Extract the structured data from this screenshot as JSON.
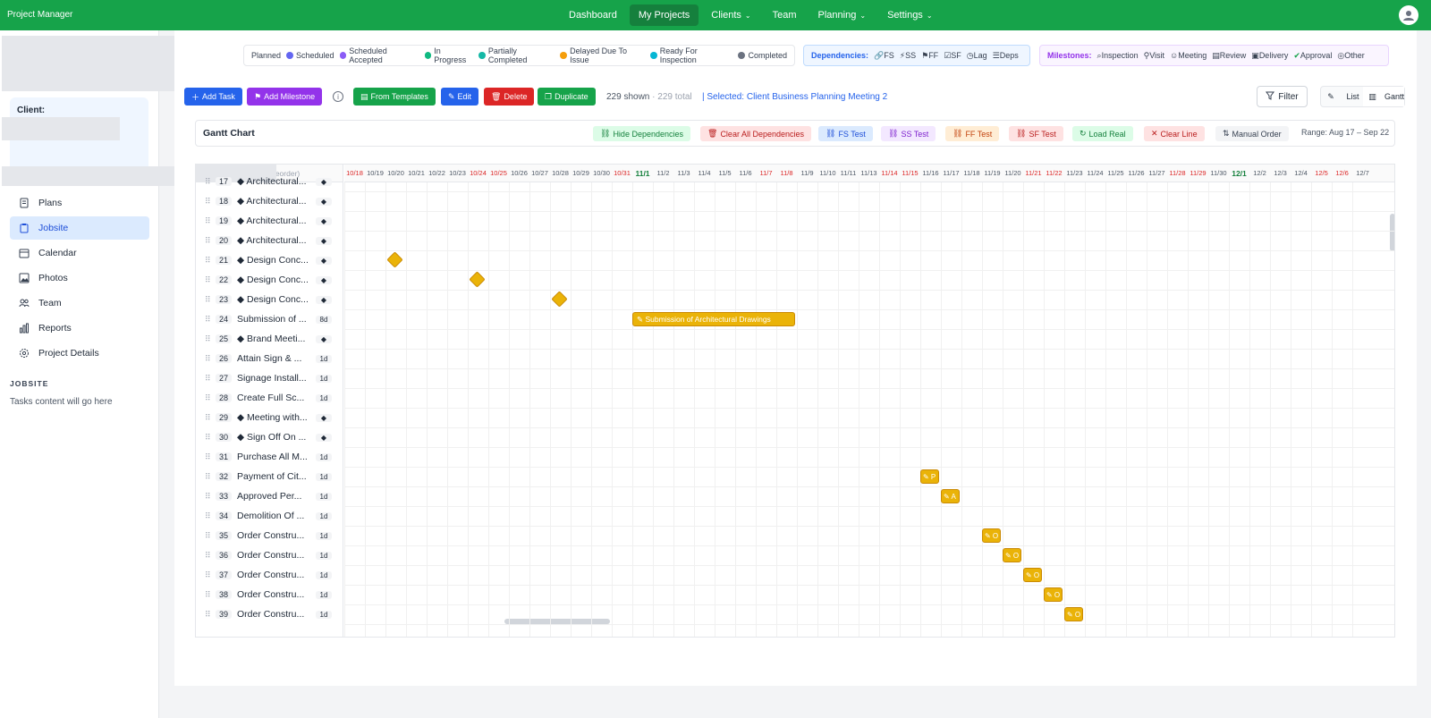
{
  "app": {
    "title": "Project Manager"
  },
  "nav": {
    "items": [
      {
        "label": "Dashboard",
        "active": false
      },
      {
        "label": "My Projects",
        "active": true
      },
      {
        "label": "Clients",
        "active": false
      },
      {
        "label": "Team",
        "active": false
      },
      {
        "label": "Planning",
        "active": false
      },
      {
        "label": "Settings",
        "active": false
      }
    ]
  },
  "sidebar": {
    "client_label": "Client:",
    "items": [
      {
        "label": "Plans",
        "icon": "document-icon"
      },
      {
        "label": "Jobsite",
        "icon": "clipboard-icon"
      },
      {
        "label": "Calendar",
        "icon": "calendar-icon"
      },
      {
        "label": "Photos",
        "icon": "photo-icon"
      },
      {
        "label": "Team",
        "icon": "team-icon"
      },
      {
        "label": "Reports",
        "icon": "reports-icon"
      },
      {
        "label": "Project Details",
        "icon": "gear-icon"
      }
    ],
    "section_title": "JOBSITE",
    "section_note": "Tasks content will go here"
  },
  "legend_status": {
    "items": [
      {
        "label": "Planned",
        "color": ""
      },
      {
        "label": "Scheduled",
        "color": "#6366f1"
      },
      {
        "label": "Scheduled Accepted",
        "color": "#8b5cf6"
      },
      {
        "label": "In Progress",
        "color": "#10b981"
      },
      {
        "label": "Partially Completed",
        "color": "#14b8a6"
      },
      {
        "label": "Delayed Due To Issue",
        "color": "#f59e0b"
      },
      {
        "label": "Ready For Inspection",
        "color": "#06b6d4"
      },
      {
        "label": "Completed",
        "color": "#6b7280"
      }
    ]
  },
  "legend_deps": {
    "title": "Dependencies:",
    "items": [
      "FS",
      "SS",
      "FF",
      "SF",
      "Lag",
      "Deps"
    ]
  },
  "legend_milestones": {
    "title": "Milestones:",
    "items": [
      "Inspection",
      "Visit",
      "Meeting",
      "Review",
      "Delivery",
      "Approval",
      "Other"
    ]
  },
  "toolbar": {
    "add_task": "Add Task",
    "add_milestone": "Add Milestone",
    "from_templates": "From Templates",
    "edit": "Edit",
    "delete": "Delete",
    "duplicate": "Duplicate",
    "shown": "229 shown",
    "total": "· 229 total",
    "selected": "| Selected: Client Business Planning Meeting 2",
    "filter": "Filter",
    "view_list": "List",
    "view_gantt": "Gantt"
  },
  "gantt_toolbar": {
    "title": "Gantt Chart",
    "hide_deps": "Hide Dependencies",
    "clear_deps": "Clear All Dependencies",
    "fs_test": "FS Test",
    "ss_test": "SS Test",
    "ff_test": "FF Test",
    "sf_test": "SF Test",
    "load_real": "Load Real",
    "clear_line": "Clear Line",
    "manual_order": "Manual Order",
    "range": "Range:  Aug 17 – Sep 22"
  },
  "gantt": {
    "reorder_hint": "reorder)",
    "dates": [
      {
        "d": "10/18",
        "k": "weekend"
      },
      {
        "d": "10/19",
        "k": ""
      },
      {
        "d": "10/20",
        "k": ""
      },
      {
        "d": "10/21",
        "k": ""
      },
      {
        "d": "10/22",
        "k": ""
      },
      {
        "d": "10/23",
        "k": ""
      },
      {
        "d": "10/24",
        "k": "weekend"
      },
      {
        "d": "10/25",
        "k": "weekend"
      },
      {
        "d": "10/26",
        "k": ""
      },
      {
        "d": "10/27",
        "k": ""
      },
      {
        "d": "10/28",
        "k": ""
      },
      {
        "d": "10/29",
        "k": ""
      },
      {
        "d": "10/30",
        "k": ""
      },
      {
        "d": "10/31",
        "k": "weekend"
      },
      {
        "d": "11/1",
        "k": "month"
      },
      {
        "d": "11/2",
        "k": ""
      },
      {
        "d": "11/3",
        "k": ""
      },
      {
        "d": "11/4",
        "k": ""
      },
      {
        "d": "11/5",
        "k": ""
      },
      {
        "d": "11/6",
        "k": ""
      },
      {
        "d": "11/7",
        "k": "weekend"
      },
      {
        "d": "11/8",
        "k": "weekend"
      },
      {
        "d": "11/9",
        "k": ""
      },
      {
        "d": "11/10",
        "k": ""
      },
      {
        "d": "11/11",
        "k": ""
      },
      {
        "d": "11/13",
        "k": ""
      },
      {
        "d": "11/14",
        "k": "weekend"
      },
      {
        "d": "11/15",
        "k": "weekend"
      },
      {
        "d": "11/16",
        "k": ""
      },
      {
        "d": "11/17",
        "k": ""
      },
      {
        "d": "11/18",
        "k": ""
      },
      {
        "d": "11/19",
        "k": ""
      },
      {
        "d": "11/20",
        "k": ""
      },
      {
        "d": "11/21",
        "k": "weekend"
      },
      {
        "d": "11/22",
        "k": "weekend"
      },
      {
        "d": "11/23",
        "k": ""
      },
      {
        "d": "11/24",
        "k": ""
      },
      {
        "d": "11/25",
        "k": ""
      },
      {
        "d": "11/26",
        "k": ""
      },
      {
        "d": "11/27",
        "k": ""
      },
      {
        "d": "11/28",
        "k": "weekend"
      },
      {
        "d": "11/29",
        "k": "weekend"
      },
      {
        "d": "11/30",
        "k": ""
      },
      {
        "d": "12/1",
        "k": "month"
      },
      {
        "d": "12/2",
        "k": ""
      },
      {
        "d": "12/3",
        "k": ""
      },
      {
        "d": "12/4",
        "k": ""
      },
      {
        "d": "12/5",
        "k": "weekend"
      },
      {
        "d": "12/6",
        "k": "weekend"
      },
      {
        "d": "12/7",
        "k": ""
      }
    ],
    "rows": [
      {
        "n": "17",
        "name": "◆ Architectural...",
        "dur": "◆"
      },
      {
        "n": "18",
        "name": "◆ Architectural...",
        "dur": "◆"
      },
      {
        "n": "19",
        "name": "◆ Architectural...",
        "dur": "◆"
      },
      {
        "n": "20",
        "name": "◆ Architectural...",
        "dur": "◆"
      },
      {
        "n": "21",
        "name": "◆ Design Conc...",
        "dur": "◆"
      },
      {
        "n": "22",
        "name": "◆ Design Conc...",
        "dur": "◆"
      },
      {
        "n": "23",
        "name": "◆ Design Conc...",
        "dur": "◆"
      },
      {
        "n": "24",
        "name": "Submission of ...",
        "dur": "8d"
      },
      {
        "n": "25",
        "name": "◆ Brand Meeti...",
        "dur": "◆"
      },
      {
        "n": "26",
        "name": "Attain Sign & ...",
        "dur": "1d"
      },
      {
        "n": "27",
        "name": "Signage Install...",
        "dur": "1d"
      },
      {
        "n": "28",
        "name": "Create Full Sc...",
        "dur": "1d"
      },
      {
        "n": "29",
        "name": "◆ Meeting with...",
        "dur": "◆"
      },
      {
        "n": "30",
        "name": "◆ Sign Off On ...",
        "dur": "◆"
      },
      {
        "n": "31",
        "name": "Purchase All M...",
        "dur": "1d"
      },
      {
        "n": "32",
        "name": "Payment of Cit...",
        "dur": "1d"
      },
      {
        "n": "33",
        "name": "Approved Per...",
        "dur": "1d"
      },
      {
        "n": "34",
        "name": "Demolition Of ...",
        "dur": "1d"
      },
      {
        "n": "35",
        "name": "Order Constru...",
        "dur": "1d"
      },
      {
        "n": "36",
        "name": "Order Constru...",
        "dur": "1d"
      },
      {
        "n": "37",
        "name": "Order Constru...",
        "dur": "1d"
      },
      {
        "n": "38",
        "name": "Order Constru...",
        "dur": "1d"
      },
      {
        "n": "39",
        "name": "Order Constru...",
        "dur": "1d"
      }
    ],
    "milestones": [
      {
        "row": 4,
        "date": "10/20"
      },
      {
        "row": 5,
        "date": "10/24"
      },
      {
        "row": 6,
        "date": "10/28"
      }
    ],
    "bars": [
      {
        "row": 7,
        "start": "11/1",
        "days": 8,
        "label": "Submission of Architectural Drawings"
      },
      {
        "row": 15,
        "start": "11/16",
        "days": 1,
        "label": "P"
      },
      {
        "row": 16,
        "start": "11/17",
        "days": 1,
        "label": "A"
      },
      {
        "row": 18,
        "start": "11/19",
        "days": 1,
        "label": "O"
      },
      {
        "row": 19,
        "start": "11/20",
        "days": 1,
        "label": "O"
      },
      {
        "row": 20,
        "start": "11/21",
        "days": 1,
        "label": "O"
      },
      {
        "row": 21,
        "start": "11/22",
        "days": 1,
        "label": "O"
      },
      {
        "row": 22,
        "start": "11/23",
        "days": 1,
        "label": "O"
      }
    ]
  }
}
